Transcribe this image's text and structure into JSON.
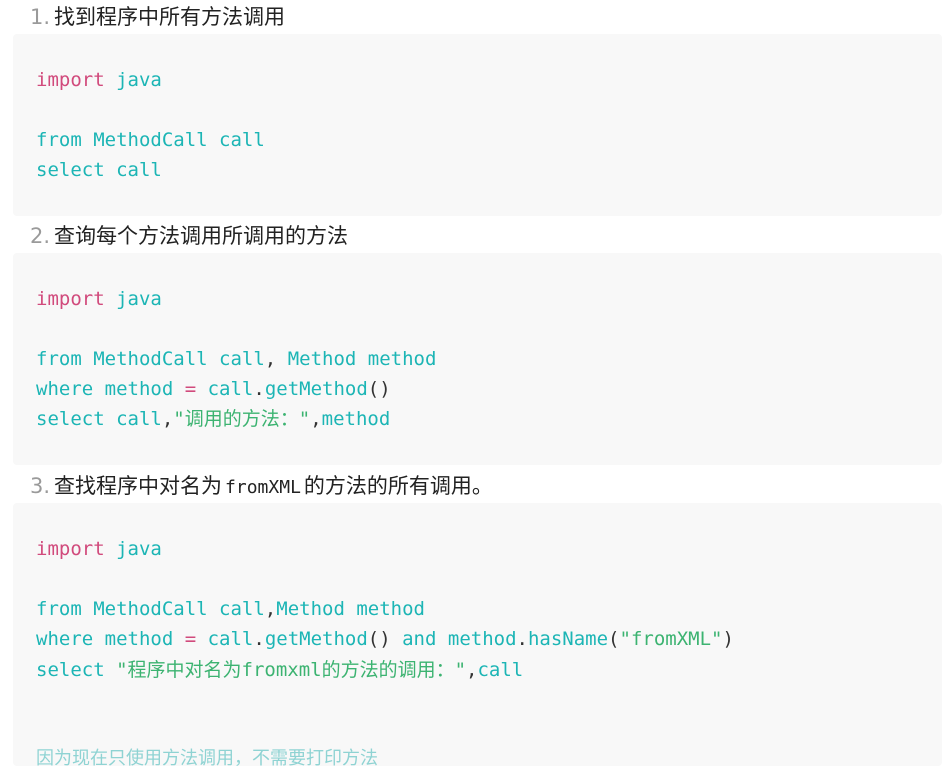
{
  "items": [
    {
      "number": "1.",
      "heading": "找到程序中所有方法调用",
      "code": {
        "line1_kw": "import",
        "line1_rest": " java",
        "line2_kw": "from",
        "line2_rest": " MethodCall call",
        "line3_kw": "select",
        "line3_rest": " call"
      }
    },
    {
      "number": "2.",
      "heading": "查询每个方法调用所调用的方法",
      "code": {
        "line1_kw": "import",
        "line1_rest": " java",
        "line2_kw": "from",
        "line2_a": " MethodCall call",
        "line2_p": ",",
        "line2_b": " Method method",
        "line3_kw": "where",
        "line3_a": " method ",
        "line3_op": "=",
        "line3_b": " call",
        "line3_dot": ".",
        "line3_fn": "getMethod",
        "line3_paren": "()",
        "line4_kw": "select",
        "line4_a": " call",
        "line4_p1": ",",
        "line4_str": "\"调用的方法：\"",
        "line4_p2": ",",
        "line4_b": "method"
      }
    },
    {
      "number": "3.",
      "heading_before": "查找程序中对名为",
      "heading_code": "fromXML",
      "heading_after": "的方法的所有调用。",
      "code": {
        "line1_kw": "import",
        "line1_rest": " java",
        "line2_kw": "from",
        "line2_a": " MethodCall call",
        "line2_p": ",",
        "line2_b": "Method method",
        "line3_kw": "where",
        "line3_a": " method ",
        "line3_op": "=",
        "line3_b": " call",
        "line3_dot": ".",
        "line3_fn": "getMethod",
        "line3_paren": "()",
        "line3_and": " and",
        "line3_c": " method",
        "line3_dot2": ".",
        "line3_fn2": "hasName",
        "line3_lp": "(",
        "line3_str": "\"fromXML\"",
        "line3_rp": ")",
        "line4_kw": "select",
        "line4_str": " \"程序中对名为fromxml的方法的调用：\"",
        "line4_p": ",",
        "line4_b": "call",
        "comment": "因为现在只使用方法调用，不需要打印方法"
      }
    }
  ]
}
